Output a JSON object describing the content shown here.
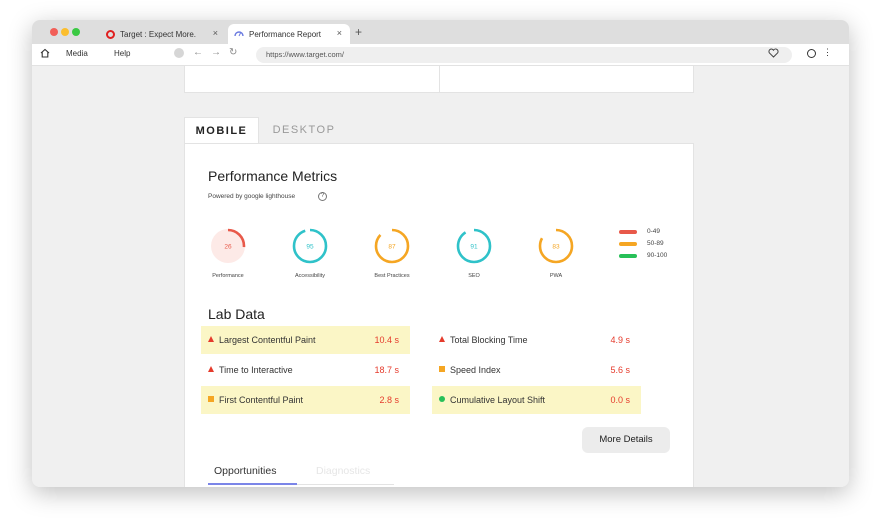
{
  "browser": {
    "tabs": [
      {
        "label": "Target : Expect More.",
        "close": "×",
        "active": false
      },
      {
        "label": "Performance Report",
        "close": "×",
        "active": true
      }
    ],
    "new_tab": "+",
    "menu": [
      "Media",
      "Help"
    ],
    "url": "https://www.target.com/"
  },
  "device_tabs": [
    {
      "label": "MOBILE",
      "active": true
    },
    {
      "label": "DESKTOP",
      "active": false
    }
  ],
  "performance": {
    "title": "Performance Metrics",
    "subtitle": "Powered by google lighthouse",
    "help": "?"
  },
  "gauges": [
    {
      "label": "Performance",
      "score": "26",
      "value": 26,
      "color": "#e8594a"
    },
    {
      "label": "Accessibility",
      "score": "95",
      "value": 95,
      "color": "#2fc2c9"
    },
    {
      "label": "Best Practices",
      "score": "87",
      "value": 87,
      "color": "#f5a623"
    },
    {
      "label": "SEO",
      "score": "91",
      "value": 91,
      "color": "#2fc2c9"
    },
    {
      "label": "PWA",
      "score": "83",
      "value": 83,
      "color": "#f5a623"
    }
  ],
  "legend": [
    {
      "range": "0-49",
      "color": "#e8594a"
    },
    {
      "range": "50-89",
      "color": "#f5a623"
    },
    {
      "range": "90-100",
      "color": "#27c058"
    }
  ],
  "lab": {
    "title": "Lab Data",
    "metrics": [
      {
        "name": "Largest Contentful Paint",
        "value": "10.4 s",
        "status": "poor",
        "highlight": true
      },
      {
        "name": "Total Blocking Time",
        "value": "4.9 s",
        "status": "poor",
        "highlight": false
      },
      {
        "name": "Time to Interactive",
        "value": "18.7 s",
        "status": "poor",
        "highlight": false
      },
      {
        "name": "Speed Index",
        "value": "5.6 s",
        "status": "average",
        "highlight": false
      },
      {
        "name": "First Contentful Paint",
        "value": "2.8 s",
        "status": "average",
        "highlight": true
      },
      {
        "name": "Cumulative Layout Shift",
        "value": "0.0 s",
        "status": "good",
        "highlight": true
      }
    ],
    "more_details": "More Details"
  },
  "bottom_tabs": [
    {
      "label": "Opportunities",
      "active": true
    },
    {
      "label": "Diagnostics",
      "active": false
    }
  ],
  "colors": {
    "poor": "#e53b2c",
    "average": "#f5a623",
    "good": "#27c058",
    "highlight": "#fbf6c6",
    "accent": "#7b85e8"
  }
}
